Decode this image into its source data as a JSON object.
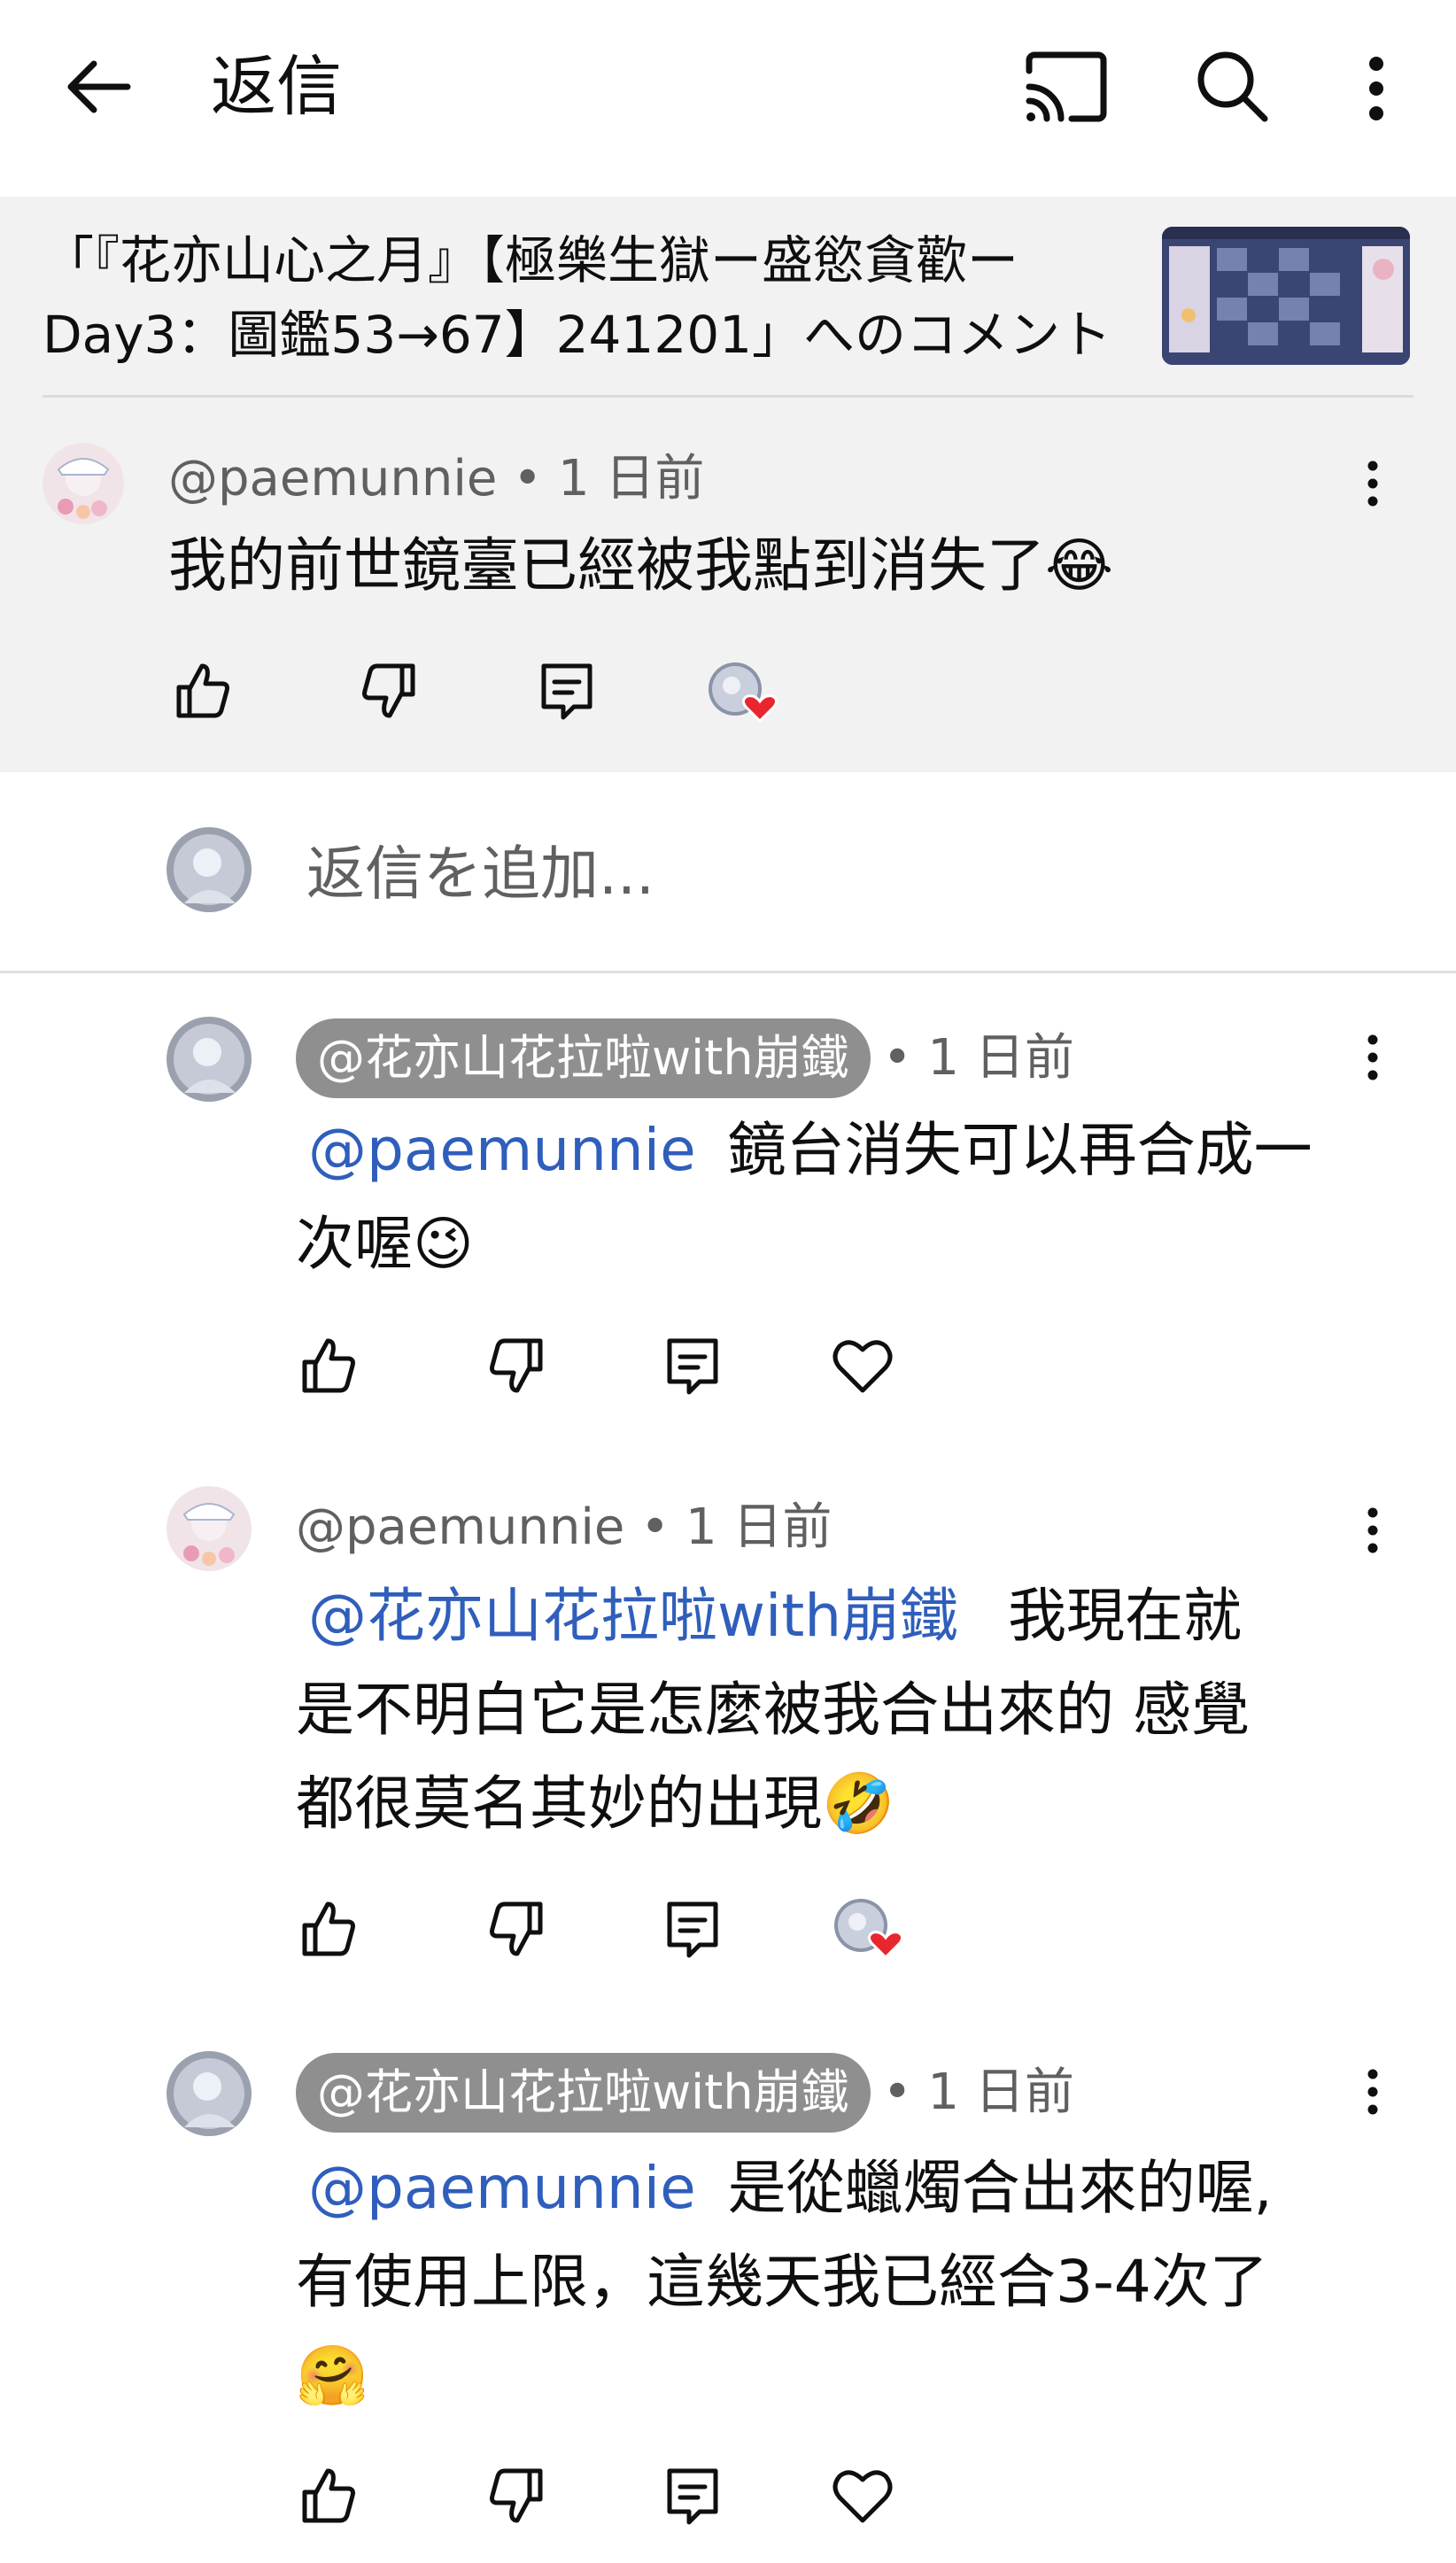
{
  "header": {
    "title": "返信"
  },
  "video": {
    "title_line1": "「『花亦山心之月』【極樂生獄ー盛慾貪歡ー",
    "title_line2": "Day3：圖鑑53→67】241201」へのコメント"
  },
  "parent_comment": {
    "handle": "@paemunnie",
    "time": "• 1 日前",
    "text": "我的前世鏡臺已經被我點到消失了😂"
  },
  "reply_input": {
    "placeholder": "返信を追加..."
  },
  "replies": [
    {
      "handle": "@花亦山花拉啦with崩鐵",
      "is_creator": true,
      "time": "• 1 日前",
      "mention": "@paemunnie",
      "text_line1": "鏡台消失可以再合成一",
      "text_line2": "次喔😉"
    },
    {
      "handle": "@paemunnie",
      "is_creator": false,
      "time": "• 1 日前",
      "mention": "@花亦山花拉啦with崩鐵",
      "text_line1": "我現在就",
      "text_line2": "是不明白它是怎麼被我合出來的 感覺",
      "text_line3": "都很莫名其妙的出現🤣"
    },
    {
      "handle": "@花亦山花拉啦with崩鐵",
      "is_creator": true,
      "time": "• 1 日前",
      "mention": "@paemunnie",
      "text_line1": "是從蠟燭合出來的喔,",
      "text_line2": "有使用上限，這幾天我已經合3-4次了",
      "text_line3": "🤗"
    }
  ],
  "colors": {
    "mention": "#2f5ebc",
    "heart": "#e8262f",
    "highlight_bg": "#f2f2f2",
    "chip_bg": "#8f8f8f"
  },
  "icons": [
    "back-arrow-icon",
    "cast-icon",
    "search-icon",
    "more-vert-icon",
    "thumb-up-icon",
    "thumb-down-icon",
    "reply-icon",
    "heart-icon",
    "creator-heart-icon"
  ]
}
